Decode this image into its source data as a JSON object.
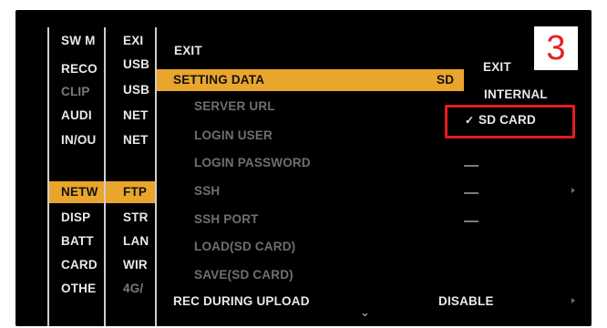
{
  "col1": [
    "SW M",
    "RECO",
    "CLIP",
    "AUDI",
    "IN/OU",
    "NETW",
    "DISP",
    "BATT",
    "CARD",
    "OTHE"
  ],
  "col2": [
    "EXI",
    "USB",
    "USB",
    "NET",
    "NET",
    "FTP",
    "STR",
    "LAN",
    "WIR",
    "4G/"
  ],
  "main": {
    "exit": "EXIT",
    "setting_data": "SETTING DATA",
    "setting_data_value": "SD",
    "items": [
      "SERVER URL",
      "LOGIN USER",
      "LOGIN PASSWORD",
      "SSH",
      "SSH PORT",
      "LOAD(SD CARD)",
      "SAVE(SD CARD)"
    ],
    "rec_during_upload": "REC DURING UPLOAD",
    "rec_during_upload_value": "DISABLE",
    "scroll_indicator": "⌄"
  },
  "right": {
    "exit": "EXIT",
    "internal": "INTERNAL",
    "sd_card_check": "✓",
    "sd_card": "SD CARD"
  },
  "step_badge": "3",
  "colors": {
    "highlight": "#e9a52c",
    "frame": "#e61c1c",
    "badge": "#e32020"
  }
}
